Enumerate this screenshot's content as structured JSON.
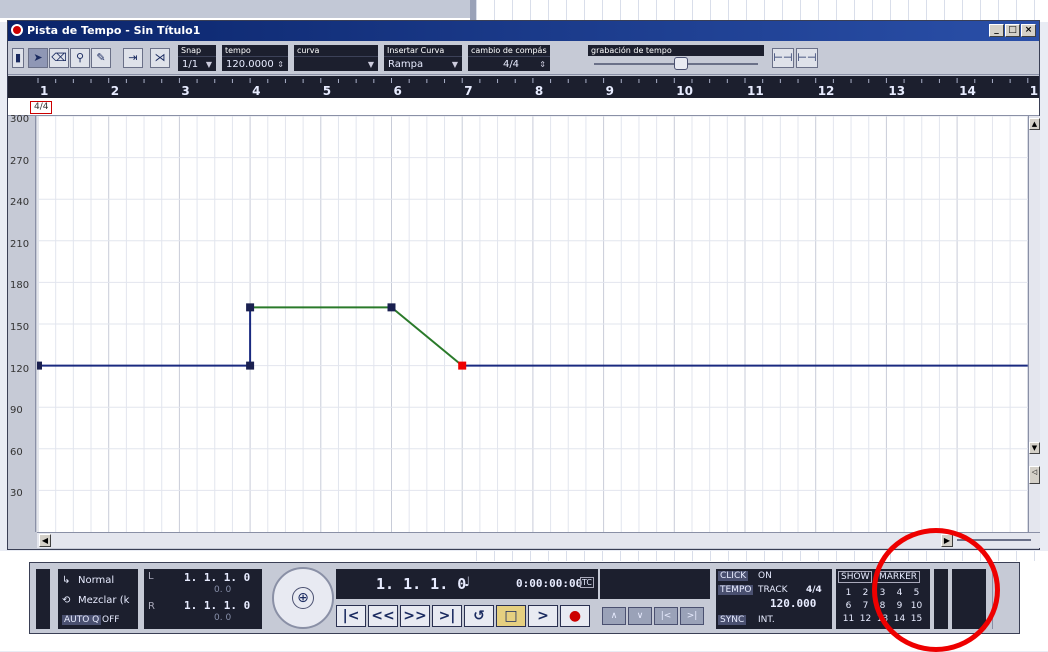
{
  "window": {
    "title": "Pista de Tempo - Sin Título1",
    "buttons": [
      "_",
      "□",
      "×"
    ]
  },
  "toolbar": {
    "snap": {
      "label": "Snap",
      "value": "1/1"
    },
    "tempo": {
      "label": "tempo",
      "value": "120.0000"
    },
    "curva": {
      "label": "curva",
      "value": ""
    },
    "insertar": {
      "label": "Insertar Curva",
      "value": "Rampa"
    },
    "cambio": {
      "label": "cambio de compás",
      "value": "4/4"
    },
    "grabacion": {
      "label": "grabación de tempo"
    }
  },
  "ruler": {
    "bars": [
      "1",
      "2",
      "3",
      "4",
      "5",
      "6",
      "7",
      "8",
      "9",
      "10",
      "11",
      "12",
      "13",
      "14",
      "1"
    ]
  },
  "signature": "4/4",
  "chart_data": {
    "type": "line",
    "title": "",
    "xlabel": "",
    "ylabel": "",
    "ylim": [
      0,
      300
    ],
    "y_ticks": [
      300,
      270,
      240,
      210,
      180,
      150,
      120,
      90,
      60,
      30
    ],
    "x_ticks": [
      "1",
      "2",
      "3",
      "4",
      "5",
      "6",
      "7",
      "8",
      "9",
      "10",
      "11",
      "12",
      "13",
      "14"
    ],
    "series": [
      {
        "x": [
          1,
          4,
          4,
          6,
          7,
          15
        ],
        "y": [
          120,
          120,
          162,
          162,
          120,
          120
        ]
      }
    ]
  },
  "transport": {
    "mode_normal": "Normal",
    "mode_mix": "Mezclar (k",
    "autoq": "AUTO Q",
    "autoq_state": "OFF",
    "L_pos": "1. 1. 1.  0",
    "R_pos": "1. 1. 1.  0",
    "L_sub": "0.  0",
    "R_sub": "0.  0",
    "position": "1. 1. 1.  0",
    "time": "0:00:00:00",
    "tc": "TC",
    "click": "CLICK",
    "click_state": "ON",
    "tempo_label": "TEMPO",
    "track_label": "TRACK",
    "track_sig": "4/4",
    "track_tempo": "120.000",
    "sync": "SYNC",
    "sync_state": "INT.",
    "show": "SHOW",
    "marker": "MARKER",
    "marker_numbers": [
      "1",
      "2",
      "3",
      "4",
      "5",
      "6",
      "7",
      "8",
      "9",
      "10",
      "11",
      "12",
      "13",
      "14",
      "15"
    ]
  }
}
